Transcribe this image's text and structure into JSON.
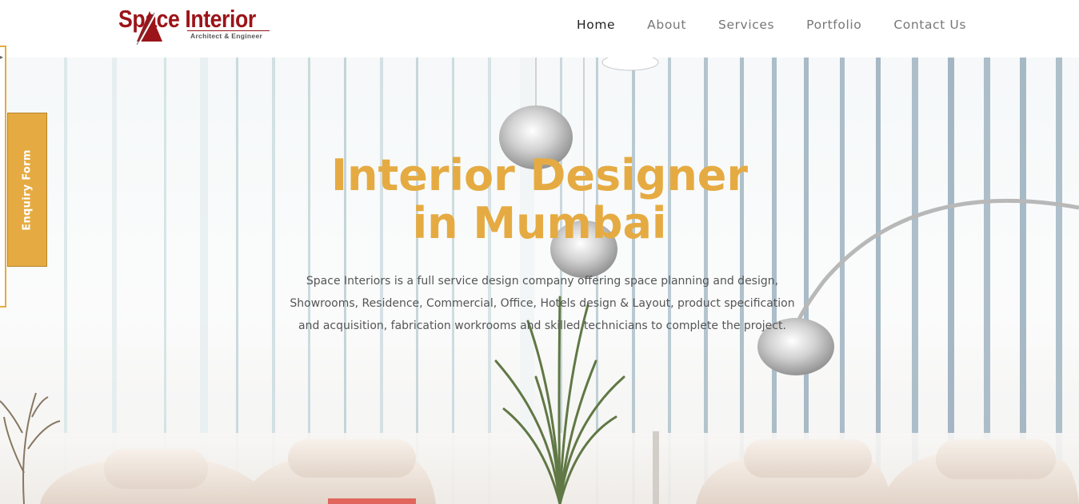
{
  "logo": {
    "name": "Space Interior",
    "tagline": "Architect & Engineer",
    "brand_color": "#9b1419"
  },
  "nav": {
    "items": [
      {
        "label": "Home",
        "active": true
      },
      {
        "label": "About",
        "active": false
      },
      {
        "label": "Services",
        "active": false
      },
      {
        "label": "Portfolio",
        "active": false
      },
      {
        "label": "Contact Us",
        "active": false
      }
    ]
  },
  "hero": {
    "title_line1": "Interior Designer",
    "title_line2": "in Mumbai",
    "description_line1": "Space Interiors is a full service design company offering space planning and design,",
    "description_line2": "Showrooms, Residence, Commercial, Office, Hotels design & Layout, product specification",
    "description_line3": "and acquisition, fabrication workrooms and skilled technicians to complete the project.",
    "accent_color": "#e5ab42"
  },
  "enquiry": {
    "label": "Enquiry Form"
  }
}
